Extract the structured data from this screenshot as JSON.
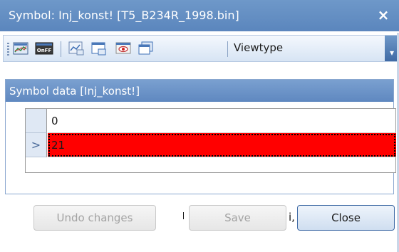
{
  "window": {
    "title": "Symbol: Inj_konst! [T5_B234R_1998.bin]",
    "close_glyph": "×"
  },
  "toolbar": {
    "items": [
      {
        "icon": "chart-view-icon"
      },
      {
        "icon": "onoff-icon",
        "label": "OnFF"
      },
      {
        "icon": "graph-icon"
      },
      {
        "icon": "window-icon"
      },
      {
        "icon": "eye-icon"
      },
      {
        "icon": "copy-window-icon"
      }
    ],
    "viewtype_label": "Viewtype",
    "overflow_glyph": "▾"
  },
  "panel": {
    "header": "Symbol data [Inj_konst!]"
  },
  "grid": {
    "rows": [
      {
        "value": "0",
        "selected": false,
        "indicator": ""
      },
      {
        "value": "21",
        "selected": true,
        "indicator": ">"
      }
    ]
  },
  "buttons": {
    "undo": "Undo changes",
    "left_fragment": "",
    "save": "Save",
    "mid_fragment": "i,",
    "close": "Close"
  },
  "colors": {
    "title_bar": "#6e98c9",
    "panel_header": "#7aa0d0",
    "selected_row": "#ff0000",
    "button_border": "#3f6aa5"
  }
}
